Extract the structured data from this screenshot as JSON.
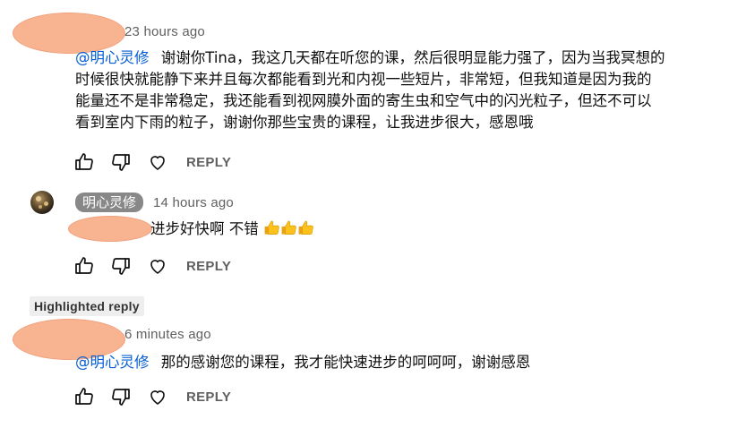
{
  "comments": [
    {
      "timestamp": "23 hours ago",
      "mention": "@明心灵修",
      "text_lines": [
        "谢谢你Tina，我这几天都在听您的课，然后很明显能力强了，因为当我冥想的",
        "时候很快就能静下来并且每次都能看到光和内视一些短片，非常短，但我知道是因为我的",
        "能量还不是非常稳定，我还能看到视网膜外面的寄生虫和空气中的闪光粒子，但还不可以",
        "看到室内下雨的粒子，谢谢你那些宝贵的课程，让我进步很大，感恩哦"
      ],
      "reply_label": "REPLY"
    },
    {
      "author": "明心灵修",
      "timestamp": "14 hours ago",
      "text": "进步好快啊 不错",
      "emoji": [
        "thumbs-up",
        "thumbs-up",
        "thumbs-up"
      ],
      "reply_label": "REPLY"
    },
    {
      "badge": "Highlighted reply",
      "timestamp": "6 minutes ago",
      "mention": "@明心灵修",
      "text": "那的感谢您的课程，我才能快速进步的呵呵呵，谢谢感恩",
      "reply_label": "REPLY"
    }
  ],
  "icons": {
    "like": "thumbs-up-outline-icon",
    "dislike": "thumbs-down-outline-icon",
    "heart": "heart-outline-icon"
  },
  "colors": {
    "mention": "#065fd4",
    "meta": "#606060",
    "chip_bg": "#888888",
    "redaction": "#f8b391"
  }
}
